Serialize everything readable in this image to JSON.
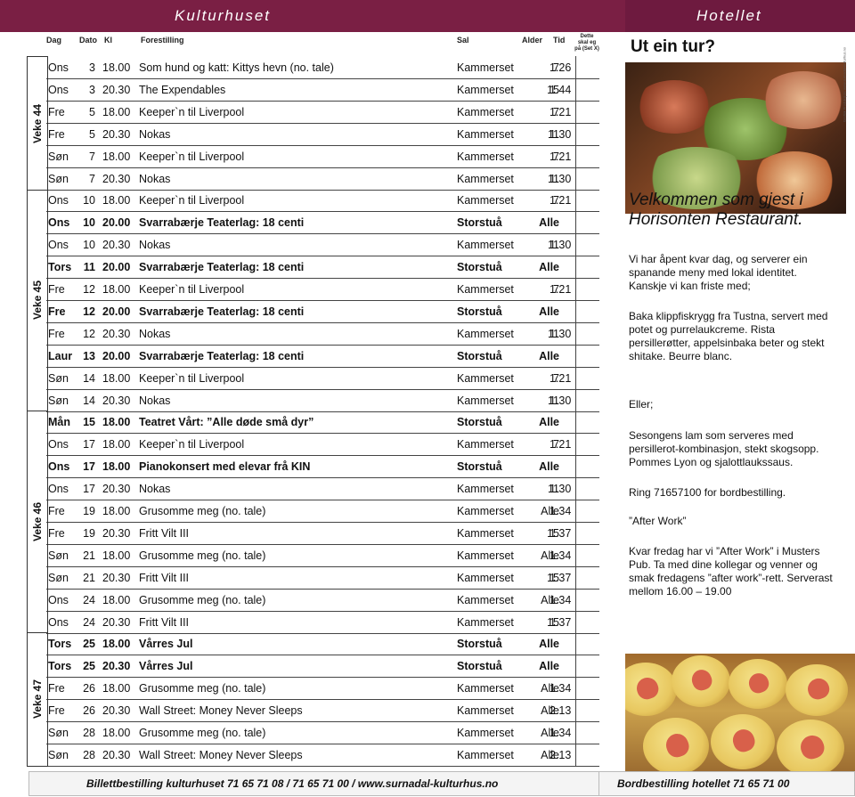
{
  "header": {
    "left_title": "Kulturhuset",
    "right_title": "Hotellet"
  },
  "columns": {
    "dag": "Dag",
    "dato": "Dato",
    "kl": "Kl",
    "forestilling": "Forestilling",
    "sal": "Sal",
    "alder": "Alder",
    "tid": "Tid",
    "dette": "Dette skal eg på (Set X)"
  },
  "weeks": [
    "Veke 44",
    "Veke 45",
    "Veke 46",
    "Veke 47"
  ],
  "rows": [
    {
      "dag": "Ons",
      "dato": "3",
      "kl": "18.00",
      "title": "Som hund og katt: Kittys hevn (no. tale)",
      "sal": "Kammerset",
      "alder": "7",
      "tid": "1.26",
      "bold": false
    },
    {
      "dag": "Ons",
      "dato": "3",
      "kl": "20.30",
      "title": "The Expendables",
      "sal": "Kammerset",
      "alder": "15",
      "tid": "1.44",
      "bold": false
    },
    {
      "dag": "Fre",
      "dato": "5",
      "kl": "18.00",
      "title": "Keeper`n til Liverpool",
      "sal": "Kammerset",
      "alder": "7",
      "tid": "1.21",
      "bold": false
    },
    {
      "dag": "Fre",
      "dato": "5",
      "kl": "20.30",
      "title": "Nokas",
      "sal": "Kammerset",
      "alder": "11",
      "tid": "1.30",
      "bold": false
    },
    {
      "dag": "Søn",
      "dato": "7",
      "kl": "18.00",
      "title": "Keeper`n til Liverpool",
      "sal": "Kammerset",
      "alder": "7",
      "tid": "1.21",
      "bold": false
    },
    {
      "dag": "Søn",
      "dato": "7",
      "kl": "20.30",
      "title": "Nokas",
      "sal": "Kammerset",
      "alder": "11",
      "tid": "1.30",
      "bold": false
    },
    {
      "dag": "Ons",
      "dato": "10",
      "kl": "18.00",
      "title": "Keeper`n til Liverpool",
      "sal": "Kammerset",
      "alder": "7",
      "tid": "1.21",
      "bold": false
    },
    {
      "dag": "Ons",
      "dato": "10",
      "kl": "20.00",
      "title": "Svarrabærje Teaterlag: 18 centi",
      "sal": "Storstuå",
      "alder": "Alle",
      "tid": "",
      "bold": true
    },
    {
      "dag": "Ons",
      "dato": "10",
      "kl": "20.30",
      "title": "Nokas",
      "sal": "Kammerset",
      "alder": "11",
      "tid": "1.30",
      "bold": false
    },
    {
      "dag": "Tors",
      "dato": "11",
      "kl": "20.00",
      "title": "Svarrabærje Teaterlag: 18 centi",
      "sal": "Storstuå",
      "alder": "Alle",
      "tid": "",
      "bold": true
    },
    {
      "dag": "Fre",
      "dato": "12",
      "kl": "18.00",
      "title": "Keeper`n til Liverpool",
      "sal": "Kammerset",
      "alder": "7",
      "tid": "1.21",
      "bold": false
    },
    {
      "dag": "Fre",
      "dato": "12",
      "kl": "20.00",
      "title": "Svarrabærje Teaterlag: 18 centi",
      "sal": "Storstuå",
      "alder": "Alle",
      "tid": "",
      "bold": true
    },
    {
      "dag": "Fre",
      "dato": "12",
      "kl": "20.30",
      "title": "Nokas",
      "sal": "Kammerset",
      "alder": "11",
      "tid": "1.30",
      "bold": false
    },
    {
      "dag": "Laur",
      "dato": "13",
      "kl": "20.00",
      "title": "Svarrabærje Teaterlag: 18 centi",
      "sal": "Storstuå",
      "alder": "Alle",
      "tid": "",
      "bold": true
    },
    {
      "dag": "Søn",
      "dato": "14",
      "kl": "18.00",
      "title": "Keeper`n til Liverpool",
      "sal": "Kammerset",
      "alder": "7",
      "tid": "1.21",
      "bold": false
    },
    {
      "dag": "Søn",
      "dato": "14",
      "kl": "20.30",
      "title": "Nokas",
      "sal": "Kammerset",
      "alder": "11",
      "tid": "1.30",
      "bold": false
    },
    {
      "dag": "Mån",
      "dato": "15",
      "kl": "18.00",
      "title": "Teatret Vårt: ”Alle døde små dyr”",
      "sal": "Storstuå",
      "alder": "Alle",
      "tid": "",
      "bold": true
    },
    {
      "dag": "Ons",
      "dato": "17",
      "kl": "18.00",
      "title": "Keeper`n til Liverpool",
      "sal": "Kammerset",
      "alder": "7",
      "tid": "1.21",
      "bold": false
    },
    {
      "dag": "Ons",
      "dato": "17",
      "kl": "18.00",
      "title": "Pianokonsert med elevar frå KIN",
      "sal": "Storstuå",
      "alder": "Alle",
      "tid": "",
      "bold": true
    },
    {
      "dag": "Ons",
      "dato": "17",
      "kl": "20.30",
      "title": "Nokas",
      "sal": "Kammerset",
      "alder": "11",
      "tid": "1.30",
      "bold": false
    },
    {
      "dag": "Fre",
      "dato": "19",
      "kl": "18.00",
      "title": "Grusomme meg (no. tale)",
      "sal": "Kammerset",
      "alder": "Alle",
      "tid": "1.34",
      "bold": false
    },
    {
      "dag": "Fre",
      "dato": "19",
      "kl": "20.30",
      "title": "Fritt Vilt III",
      "sal": "Kammerset",
      "alder": "15",
      "tid": "1.37",
      "bold": false
    },
    {
      "dag": "Søn",
      "dato": "21",
      "kl": "18.00",
      "title": "Grusomme meg (no. tale)",
      "sal": "Kammerset",
      "alder": "Alle",
      "tid": "1.34",
      "bold": false
    },
    {
      "dag": "Søn",
      "dato": "21",
      "kl": "20.30",
      "title": "Fritt Vilt III",
      "sal": "Kammerset",
      "alder": "15",
      "tid": "1.37",
      "bold": false
    },
    {
      "dag": "Ons",
      "dato": "24",
      "kl": "18.00",
      "title": "Grusomme meg (no. tale)",
      "sal": "Kammerset",
      "alder": "Alle",
      "tid": "1.34",
      "bold": false
    },
    {
      "dag": "Ons",
      "dato": "24",
      "kl": "20.30",
      "title": "Fritt Vilt III",
      "sal": "Kammerset",
      "alder": "15",
      "tid": "1.37",
      "bold": false
    },
    {
      "dag": "Tors",
      "dato": "25",
      "kl": "18.00",
      "title": "Vårres Jul",
      "sal": "Storstuå",
      "alder": "Alle",
      "tid": "",
      "bold": true
    },
    {
      "dag": "Tors",
      "dato": "25",
      "kl": "20.30",
      "title": "Vårres Jul",
      "sal": "Storstuå",
      "alder": "Alle",
      "tid": "",
      "bold": true
    },
    {
      "dag": "Fre",
      "dato": "26",
      "kl": "18.00",
      "title": "Grusomme meg (no. tale)",
      "sal": "Kammerset",
      "alder": "Alle",
      "tid": "1.34",
      "bold": false
    },
    {
      "dag": "Fre",
      "dato": "26",
      "kl": "20.30",
      "title": "Wall Street: Money Never Sleeps",
      "sal": "Kammerset",
      "alder": "Alle",
      "tid": "2.13",
      "bold": false
    },
    {
      "dag": "Søn",
      "dato": "28",
      "kl": "18.00",
      "title": "Grusomme meg (no. tale)",
      "sal": "Kammerset",
      "alder": "Alle",
      "tid": "1.34",
      "bold": false
    },
    {
      "dag": "Søn",
      "dato": "28",
      "kl": "20.30",
      "title": "Wall Street: Money Never Sleeps",
      "sal": "Kammerset",
      "alder": "Alle",
      "tid": "2.13",
      "bold": false
    }
  ],
  "hotel": {
    "heading": "Ut ein tur?",
    "welcome": "Velkommen som gjest i Horisonten Restaurant.",
    "p1": "Vi har åpent kvar dag, og serverer ein spanande meny med lokal identitet. Kanskje vi kan friste med;",
    "p2": "Baka klippfiskrygg fra Tustna, servert med potet og purrelaukcreme. Rista persillerøtter, appelsinbaka beter og stekt shitake. Beurre blanc.",
    "p3": "Eller;",
    "p4": "Sesongens lam som serveres med persillerot-kombinasjon, stekt skogsopp. Pommes Lyon og sjalottlaukssaus.",
    "p5": "Ring 71657100 for bordbestilling.",
    "p6": "”After Work”",
    "p7": "Kvar fredag har vi ”After Work” i Musters Pub. Ta med dine kollegar og venner og smak fredagens ”after work”-rett. Serverast mellom 16.00 – 19.00",
    "credit": "Grafisk Produksjon: www.surnadal-kulturhus.no"
  },
  "footer": {
    "left": "Billettbestilling kulturhuset 71 65 71 08 / 71 65 71 00 / www.surnadal-kulturhus.no",
    "right": "Bordbestilling hotellet 71 65 71 00"
  }
}
